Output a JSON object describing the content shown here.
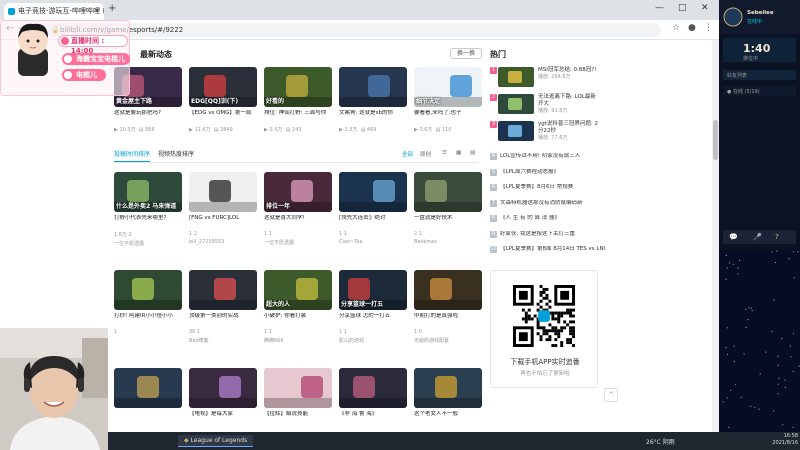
{
  "browser": {
    "tab_title": "电子竞技-游玩互-哔哩哔哩 (゜-゜)",
    "url": "bilibili.com/v/game/esports/#/9222",
    "new_tab": "+",
    "minimize": "—",
    "maximize": "□",
    "close": "✕"
  },
  "page": {
    "latest_title": "最新动态",
    "swap_label": "换一换",
    "hot_title": "热门",
    "latest_cards": [
      {
        "tag": "黄金屋主下路",
        "title": "这就是要玩那把吗?",
        "views": "10.3万",
        "danmaku": "886"
      },
      {
        "tag": "EDG[QQ]训(下)",
        "title": "【EDG vs OMG】第一局",
        "views": "11.6万",
        "danmaku": "2849"
      },
      {
        "tag": "好看的",
        "title": "排位: 神仙打野: 三面与你",
        "views": "3.9万",
        "danmaku": "243"
      },
      {
        "tag": "",
        "title": "文案狗: 这就是sb的你",
        "views": "1.3万",
        "danmaku": "469"
      },
      {
        "tag": "细节决定",
        "title": "要看看,来吗了,也子",
        "views": "3.6万",
        "danmaku": "110"
      }
    ],
    "sort_tabs": [
      "投稿时间排序",
      "视频热度排序"
    ],
    "sort_options": [
      "全部",
      "原创"
    ],
    "grid_cards": [
      {
        "tag": "什么是外卖2 马来弹道",
        "title": "打野小代表先来哪里?",
        "meta": "1.6万  2",
        "up": "一位不愿透露"
      },
      {
        "tag": "",
        "title": "[FNG vs FURC]LOL",
        "meta": "1  2",
        "up": "bili_27239553"
      },
      {
        "tag": "排位一年",
        "title": "这就是喜大同学!",
        "meta": "1  1",
        "up": "一位不愿透露"
      },
      {
        "tag": "",
        "title": "[领先大连击]: 绝对",
        "meta": "1  1",
        "up": "Ciao~Tea"
      },
      {
        "tag": "",
        "title": "一盘就是好技术",
        "meta": "2  1",
        "up": "Bakkmas"
      },
      {
        "tag": "",
        "title": "打秒! 阿建IR小小怪小小",
        "meta": "1",
        "up": ""
      },
      {
        "tag": "",
        "title": "顶级第一类别的实战",
        "meta": "36  1",
        "up": "Bad博客"
      },
      {
        "tag": "超大的人",
        "title": "小破护: 你看打装",
        "meta": "1  1",
        "up": "腾腾666"
      },
      {
        "tag": "分享篮球一打五",
        "title": "分享篮球 怎的一打五",
        "meta": "1  1",
        "up": "影山的游戏"
      },
      {
        "tag": "",
        "title": "中期打的是真强啦",
        "meta": "1  0",
        "up": "无敌的游戏配置"
      },
      {
        "tag": "",
        "title": "",
        "meta": "",
        "up": ""
      },
      {
        "tag": "",
        "title": "【电视】是每大家",
        "meta": "",
        "up": ""
      },
      {
        "tag": "",
        "title": "【拉辉】解说技能",
        "meta": "",
        "up": ""
      },
      {
        "tag": "",
        "title": "《非 海 鲁 海》",
        "meta": "",
        "up": ""
      },
      {
        "tag": "",
        "title": "这个老女人不一般",
        "meta": "",
        "up": ""
      }
    ],
    "hot_items": [
      {
        "rank": "1",
        "title": "MSI冠军总结: 0.88冠?!",
        "sub": "播放: 284.6万"
      },
      {
        "rank": "2",
        "title": "无法逃离下路: LOL最新开大",
        "sub": "播放: 91.8万"
      },
      {
        "rank": "3",
        "title": "ygt说科普三冠界问题: 2分22秒",
        "sub": "播放: 77.6万"
      }
    ],
    "hot_lines": [
      {
        "rank": "4",
        "title": "LOL宣传试不用! 叨家没有鼠三人"
      },
      {
        "rank": "5",
        "title": "《LPL周六赛程动态报》"
      },
      {
        "rank": "6",
        "title": "【LPL夏季赛】8月6日 常规赛"
      },
      {
        "rank": "7",
        "title": "文森特机器这那没有消防鼠编码新"
      },
      {
        "rank": "8",
        "title": "《人 生 有 的 算 法 器》"
      },
      {
        "rank": "9",
        "title": "好家伙, 我这是按这下关灯三重"
      },
      {
        "rank": "10",
        "title": "【LPL夏季赛】第8周 8月14日 TES vs LNG"
      }
    ],
    "qr_text": "下载手机APP实时追番",
    "qr_sub": "再也不怕忘了更新啦",
    "to_top": "^"
  },
  "overlay": {
    "time_label": "直播时间 : 14:00",
    "tag1": "海霸宝宝电棍儿",
    "tag2": "电棍儿"
  },
  "right_panel": {
    "user": "Sebeilee",
    "status": "在线中",
    "time": "1:40",
    "sub": "排位中",
    "party_label": "好友列表",
    "friends": [
      "● 在线 (5/19)",
      "●○○"
    ]
  },
  "taskbar": {
    "app_label": "League of Legends",
    "weather": "26°C 阴雨",
    "time": "16:58",
    "date": "2021/8/16"
  },
  "colors": {
    "accent": "#00a1d6",
    "pink": "#f25d8e"
  }
}
